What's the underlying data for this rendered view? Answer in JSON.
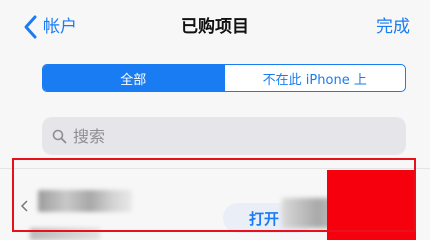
{
  "nav": {
    "back_label": "帐户",
    "title": "已购项目",
    "done_label": "完成"
  },
  "segments": {
    "all_label": "全部",
    "not_on_device_label": "不在此 iPhone 上"
  },
  "search": {
    "placeholder": "搜索"
  },
  "app_row": {
    "open_label": "打开"
  },
  "colors": {
    "accent": "#1a7cf2",
    "highlight": "#e8101a",
    "redaction": "#f5000c"
  }
}
